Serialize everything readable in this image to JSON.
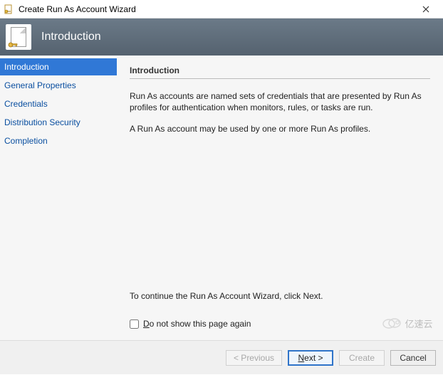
{
  "window": {
    "title": "Create Run As Account Wizard"
  },
  "banner": {
    "title": "Introduction"
  },
  "sidebar": {
    "items": [
      {
        "label": "Introduction",
        "selected": true
      },
      {
        "label": "General Properties",
        "selected": false
      },
      {
        "label": "Credentials",
        "selected": false
      },
      {
        "label": "Distribution Security",
        "selected": false
      },
      {
        "label": "Completion",
        "selected": false
      }
    ]
  },
  "content": {
    "heading": "Introduction",
    "para1": "Run As accounts are named sets of credentials that are presented by Run As profiles for authentication when monitors, rules, or tasks are run.",
    "para2": "A Run As account may be used by one or more Run As profiles.",
    "continue_hint": "To continue the Run As Account Wizard, click Next.",
    "checkbox_label_prefix": "D",
    "checkbox_label_rest": "o not show this page again"
  },
  "footer": {
    "previous": "< Previous",
    "next": "Next >",
    "create": "Create",
    "cancel": "Cancel"
  },
  "watermark": {
    "text": "亿速云"
  }
}
